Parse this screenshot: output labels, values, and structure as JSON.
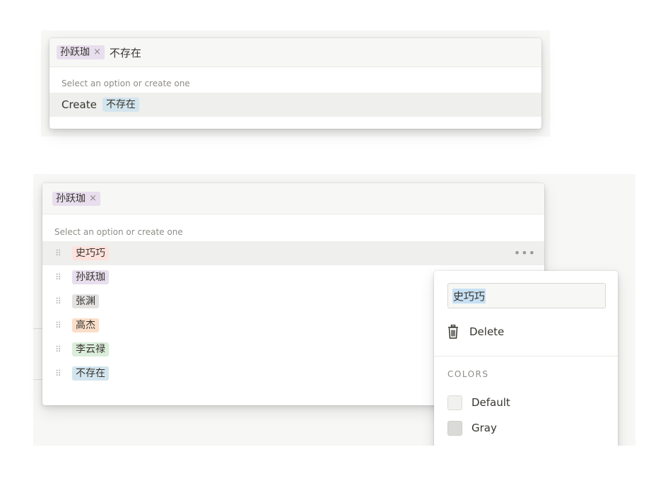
{
  "top_popup": {
    "selected_chip": "孙跃珈",
    "remove_symbol": "×",
    "typed_text": "不存在",
    "hint": "Select an option or create one",
    "create_label": "Create",
    "create_chip": "不存在"
  },
  "bottom_popup": {
    "selected_chip": "孙跃珈",
    "remove_symbol": "×",
    "hint": "Select an option or create one",
    "drag_glyph": "⠿",
    "more_glyph": "•••",
    "options": [
      {
        "label": "史巧巧",
        "color": "red"
      },
      {
        "label": "孙跃珈",
        "color": "purple"
      },
      {
        "label": "张渊",
        "color": "gray"
      },
      {
        "label": "高杰",
        "color": "orange"
      },
      {
        "label": "李云禄",
        "color": "green"
      },
      {
        "label": "不存在",
        "color": "blue"
      }
    ]
  },
  "edit_menu": {
    "name_value": "史巧巧",
    "delete_label": "Delete",
    "colors_heading": "COLORS",
    "colors": [
      {
        "label": "Default",
        "swatch": "#f1f1ef"
      },
      {
        "label": "Gray",
        "swatch": "#dadad8"
      }
    ]
  },
  "icons": {
    "trash": "trash-icon",
    "drag": "drag-handle-icon",
    "more": "more-icon"
  },
  "theme": {
    "text": "#37352f",
    "hint": "#8f8d88",
    "purple_tag": "#e8deee",
    "red_tag": "#ffe2dd",
    "gray_tag": "#e3e2e0",
    "orange_tag": "#fadec9",
    "green_tag": "#dbeddb",
    "blue_tag": "#d3e5ef",
    "selection": "#c7e0f4"
  }
}
